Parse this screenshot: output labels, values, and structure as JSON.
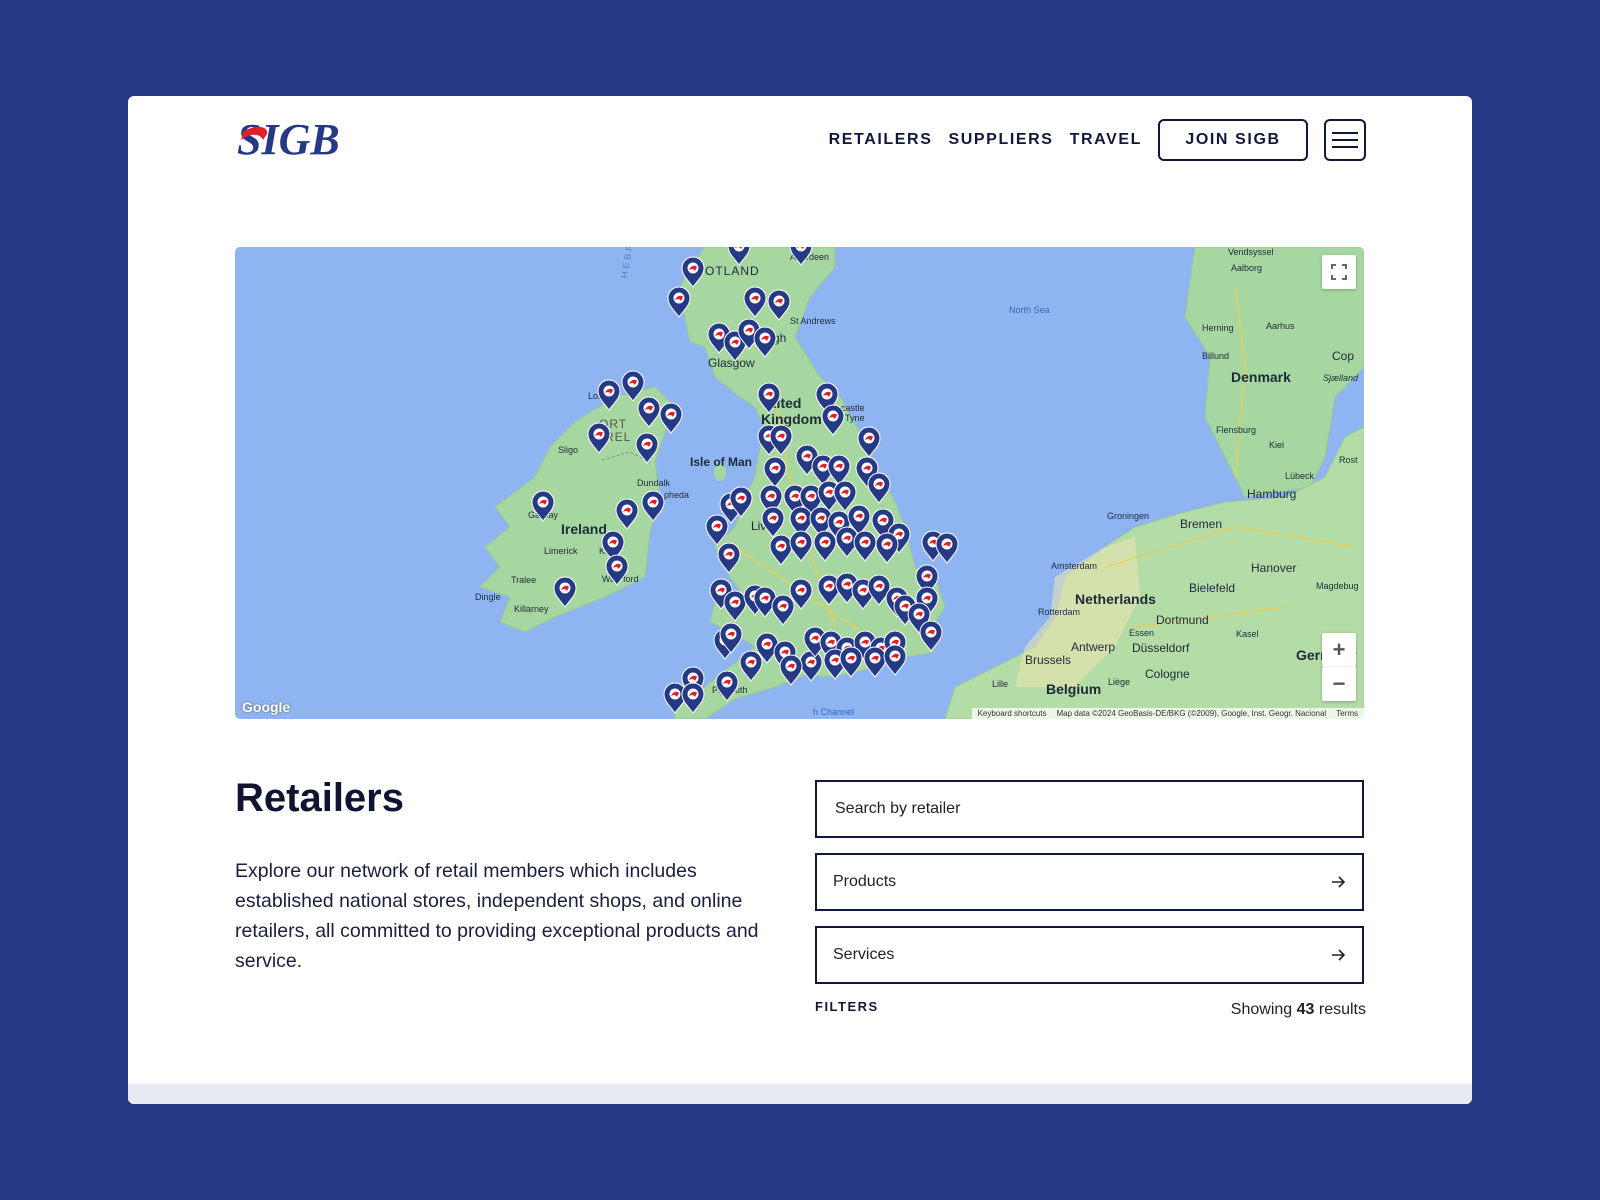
{
  "header": {
    "logo_text": "SIGB",
    "nav": [
      {
        "label": "RETAILERS"
      },
      {
        "label": "SUPPLIERS"
      },
      {
        "label": "TRAVEL"
      }
    ],
    "join_label": "JOIN SIGB"
  },
  "map": {
    "labels": {
      "scotland": "OTLAND",
      "aberdeen": "Aberdeen",
      "st_andrews": "St Andrews",
      "edinburgh": "rgh",
      "glasgow": "Glasgow",
      "hebrides": "HEBRIDES",
      "north_sea": "North Sea",
      "united": "nited",
      "kingdom": "Kingdom",
      "newcastle": "castle",
      "tyne": "Tyne",
      "isle_of_man": "Isle of Man",
      "northern_ireland": "ORT",
      "ireland_ni": "REL",
      "londonderry": "Lond",
      "sligo": "Sligo",
      "dundalk": "Dundalk",
      "drogheda": "pheda",
      "ireland": "Ireland",
      "galway": "Galway",
      "limerick": "Limerick",
      "kilkenny": "Kil",
      "waterford": "Wa",
      "waterford2": "ford",
      "tralee": "Tralee",
      "dingle": "Dingle",
      "killarney": "Killarney",
      "liverpool": "Liv",
      "plymouth": "Ply",
      "plymouth2": "uth",
      "channel": "h Channel",
      "vendsyssel": "Vendsyssel",
      "aalborg": "Aalborg",
      "denmark": "Denmark",
      "herning": "Herning",
      "aarhus": "Aarhus",
      "billund": "Billund",
      "flensburg": "Flensburg",
      "kiel": "Kiel",
      "sjaelland": "Sjælland",
      "copenhagen": "Cop",
      "lubeck": "Lübeck",
      "rostock": "Rost",
      "hamburg": "Hamburg",
      "groningen": "Groningen",
      "bremen": "Bremen",
      "amsterdam": "Amsterdam",
      "hanover": "Hanover",
      "netherlands": "Netherlands",
      "bielefeld": "Bielefeld",
      "magdeburg": "Magdebug",
      "rotterdam": "Rotterdam",
      "dortmund": "Dortmund",
      "antwerp": "Antwerp",
      "essen": "Essen",
      "kassel": "Kasel",
      "dusseldorf": "Düsseldorf",
      "brussels": "Brussels",
      "cologne": "Cologne",
      "germany": "Germany",
      "belgium": "Belgium",
      "lille": "Lille",
      "liege": "Liège"
    },
    "attribution": {
      "keyboard": "Keyboard shortcuts",
      "mapdata": "Map data ©2024 GeoBasis-DE/BKG (©2009), Google, Inst. Geogr. Nacional",
      "terms": "Terms"
    },
    "google": "Google",
    "zoom_in": "+",
    "zoom_out": "−"
  },
  "content": {
    "title": "Retailers",
    "description": "Explore our network of retail members which includes established national stores, independent shops, and online retailers, all committed to providing exceptional products and service."
  },
  "filters": {
    "search_placeholder": "Search by retailer",
    "products_label": "Products",
    "services_label": "Services",
    "filters_label": "FILTERS",
    "showing_prefix": "Showing",
    "count": "43",
    "showing_suffix": "results"
  },
  "colors": {
    "page_bg": "#263985",
    "brand_navy": "#263985",
    "brand_red": "#e0202b",
    "sea": "#8fb4f2",
    "land": "#a7d7a0"
  }
}
